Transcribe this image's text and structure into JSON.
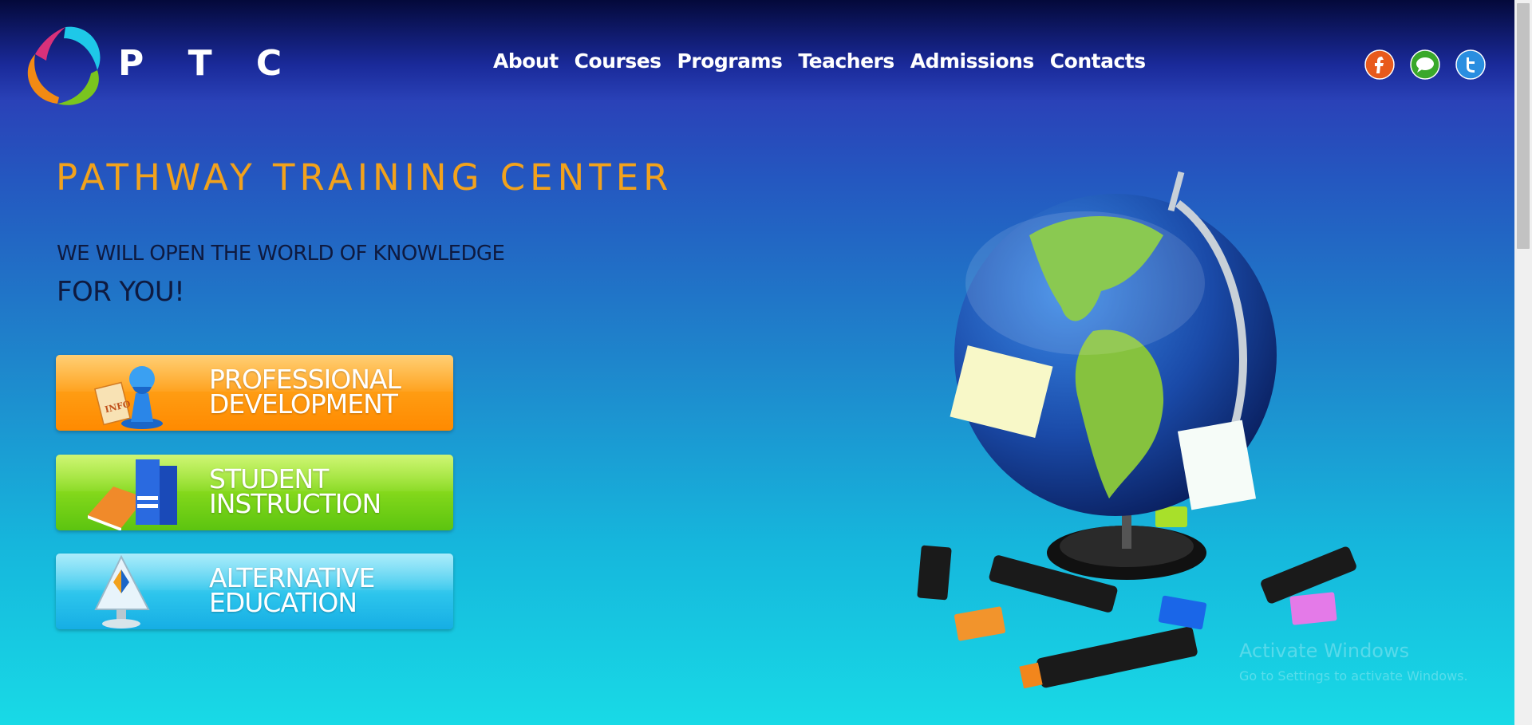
{
  "header": {
    "brand": "P T C",
    "logo_icon": "swirl-logo-icon",
    "nav": [
      "About",
      "Courses",
      "Programs",
      "Teachers",
      "Admissions",
      "Contacts"
    ],
    "social": [
      {
        "name": "facebook-icon",
        "color": "#e85a1c"
      },
      {
        "name": "chat-icon",
        "color": "#3aa82a"
      },
      {
        "name": "twitter-icon",
        "color": "#2a8ee0"
      }
    ]
  },
  "hero": {
    "title": "PATHWAY TRAINING CENTER",
    "tagline_line1": "WE WILL OPEN THE WORLD OF KNOWLEDGE",
    "tagline_line2": "FOR YOU!",
    "image_icon": "globe-icon"
  },
  "programs": [
    {
      "label": "PROFESSIONAL\nDEVELOPMENT",
      "icon": "info-chess-piece-icon",
      "color": "#ff9a10"
    },
    {
      "label": "STUDENT\nINSTRUCTION",
      "icon": "books-icon",
      "color": "#7fd61a"
    },
    {
      "label": "ALTERNATIVE\nEDUCATION",
      "icon": "monitor-icon",
      "color": "#2cc4ec"
    }
  ],
  "watermark": {
    "line1": "Activate Windows",
    "line2": "Go to Settings to activate Windows."
  },
  "colors": {
    "title": "#f2a21c",
    "tagline": "#0e1a40",
    "background_top": "#04093a",
    "background_bottom": "#18dae6"
  }
}
